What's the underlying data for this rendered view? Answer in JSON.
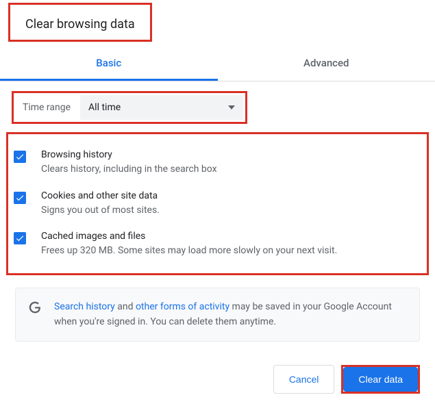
{
  "dialog": {
    "title": "Clear browsing data"
  },
  "tabs": {
    "basic": "Basic",
    "advanced": "Advanced"
  },
  "time_range": {
    "label": "Time range",
    "value": "All time"
  },
  "options": {
    "browsing_history": {
      "title": "Browsing history",
      "desc": "Clears history, including in the search box"
    },
    "cookies": {
      "title": "Cookies and other site data",
      "desc": "Signs you out of most sites."
    },
    "cached": {
      "title": "Cached images and files",
      "desc": "Frees up 320 MB. Some sites may load more slowly on your next visit."
    }
  },
  "info": {
    "link1": "Search history",
    "mid1": " and ",
    "link2": "other forms of activity",
    "rest": " may be saved in your Google Account when you're signed in. You can delete them anytime."
  },
  "buttons": {
    "cancel": "Cancel",
    "clear": "Clear data"
  }
}
